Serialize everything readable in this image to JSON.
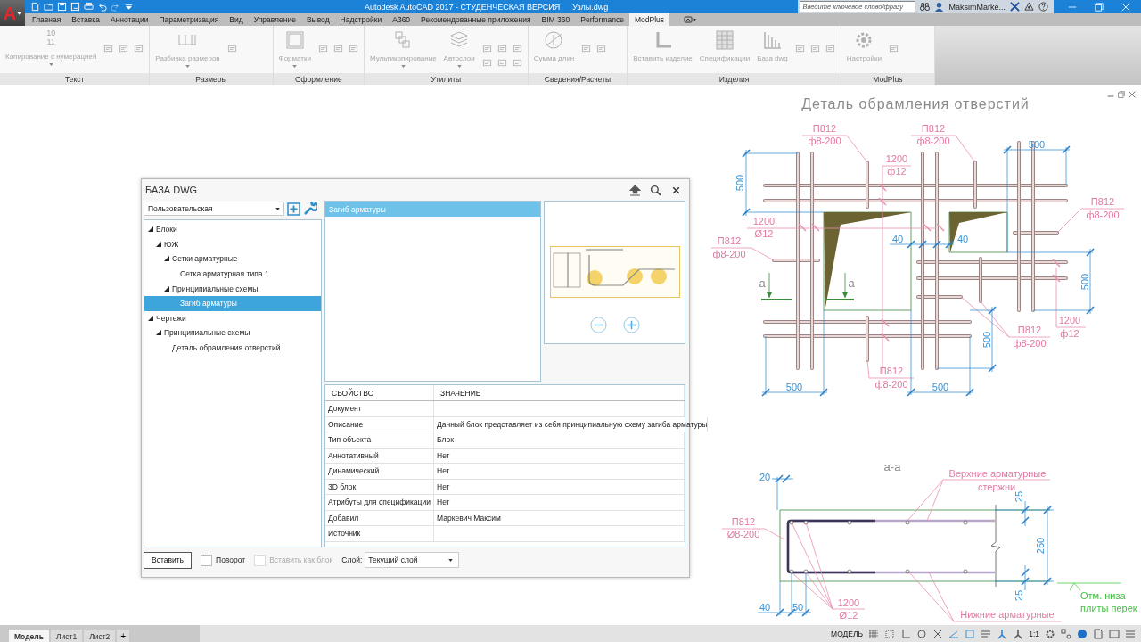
{
  "titlebar": {
    "app_letter": "A",
    "title": "Autodesk AutoCAD 2017 - СТУДЕНЧЕСКАЯ ВЕРСИЯ",
    "file": "Узлы.dwg",
    "search": {
      "placeholder": "Введите ключевое слово/фразу"
    },
    "user": "MaksimMarke..."
  },
  "ribbon_tabs": [
    {
      "label": "Главная",
      "selected": false
    },
    {
      "label": "Вставка",
      "selected": false
    },
    {
      "label": "Аннотации",
      "selected": false
    },
    {
      "label": "Параметризация",
      "selected": false
    },
    {
      "label": "Вид",
      "selected": false
    },
    {
      "label": "Управление",
      "selected": false
    },
    {
      "label": "Вывод",
      "selected": false
    },
    {
      "label": "Надстройки",
      "selected": false
    },
    {
      "label": "A360",
      "selected": false
    },
    {
      "label": "Рекомендованные приложения",
      "selected": false
    },
    {
      "label": "BIM 360",
      "selected": false
    },
    {
      "label": "Performance",
      "selected": false
    },
    {
      "label": "ModPlus",
      "selected": true
    }
  ],
  "ribbon_panels": [
    {
      "title": "Текст",
      "buttons": [
        {
          "label": "Копирование с нумерацией",
          "dropdown": true,
          "icon_text": [
            "10",
            "11"
          ]
        }
      ]
    },
    {
      "title": "Размеры",
      "buttons": [
        {
          "label": "Разбивка размеров",
          "dropdown": true
        }
      ]
    },
    {
      "title": "Оформление",
      "buttons": [
        {
          "label": "Форматки",
          "dropdown": true
        }
      ]
    },
    {
      "title": "Утилиты",
      "buttons": [
        {
          "label": "Мультикопирование",
          "dropdown": true
        },
        {
          "label": "Автослои",
          "dropdown": true
        }
      ]
    },
    {
      "title": "Сведения/Расчеты",
      "buttons": [
        {
          "label": "Сумма длин",
          "dropdown": false
        }
      ]
    },
    {
      "title": "Изделия",
      "buttons": [
        {
          "label": "Вставить изделие",
          "dropdown": false
        },
        {
          "label": "Спецификации",
          "dropdown": false
        },
        {
          "label": "База dwg",
          "dropdown": false
        }
      ]
    },
    {
      "title": "ModPlus",
      "buttons": [
        {
          "label": "Настройки",
          "dropdown": false
        }
      ]
    }
  ],
  "dialog": {
    "title": "БАЗА DWG",
    "category": {
      "value": "Пользовательская"
    },
    "tree": [
      {
        "label": "Блоки",
        "expanded": true,
        "selected": false,
        "children": [
          {
            "label": "ЮЖ",
            "expanded": true,
            "selected": false,
            "children": [
              {
                "label": "Сетки арматурные",
                "expanded": true,
                "selected": false,
                "children": [
                  {
                    "label": "Сетка арматурная типа 1",
                    "selected": false
                  }
                ]
              },
              {
                "label": "Принципиальные схемы",
                "expanded": true,
                "selected": false,
                "children": [
                  {
                    "label": "Загиб арматуры",
                    "selected": true
                  }
                ]
              }
            ]
          }
        ]
      },
      {
        "label": "Чертежи",
        "expanded": true,
        "selected": false,
        "children": [
          {
            "label": "Принципиальные схемы",
            "expanded": true,
            "selected": false,
            "children": [
              {
                "label": "Деталь обрамления отверстий",
                "selected": false
              }
            ]
          }
        ]
      }
    ],
    "items": [
      {
        "label": "Загиб арматуры",
        "selected": true
      }
    ],
    "properties": {
      "columns": [
        "СВОЙСТВО",
        "ЗНАЧЕНИЕ"
      ],
      "rows": [
        {
          "name": "Документ"
        },
        {
          "name": "Описание",
          "value": "Данный блок представляет из себя принципиальную схему загиба арматуры"
        },
        {
          "name": "Тип объекта",
          "value": "Блок"
        },
        {
          "name": "Аннотативный",
          "value": "Нет"
        },
        {
          "name": "Динамический",
          "value": "Нет"
        },
        {
          "name": "3D блок",
          "value": "Нет"
        },
        {
          "name": "Атрибуты для спецификации",
          "value": "Нет"
        },
        {
          "name": "Добавил",
          "value": "Маркевич Максим"
        },
        {
          "name": "Источник"
        }
      ]
    },
    "insert_button": "Вставить",
    "options": [
      {
        "label": "Поворот",
        "checked": false,
        "disabled": false
      },
      {
        "label": "Вставить как блок",
        "checked": false,
        "disabled": true
      }
    ],
    "layer": {
      "label": "Слой:",
      "value": "Текущий слой"
    }
  },
  "drawing": {
    "labels": [
      {
        "kind": "title",
        "text": "Деталь обрамления отверстий"
      },
      {
        "kind": "mark",
        "text": "П812"
      },
      {
        "kind": "mark",
        "text": "ф8-200"
      },
      {
        "kind": "mark",
        "text": "П812"
      },
      {
        "kind": "mark",
        "text": "ф8-200"
      },
      {
        "kind": "mark",
        "text": "1200"
      },
      {
        "kind": "mark",
        "text": "ф12"
      },
      {
        "kind": "dim",
        "text": "500"
      },
      {
        "kind": "dim_v",
        "text": "500"
      },
      {
        "kind": "mark",
        "text": "П812"
      },
      {
        "kind": "mark",
        "text": "ф8-200"
      },
      {
        "kind": "mark",
        "text": "1200"
      },
      {
        "kind": "mark",
        "text": "Ø12"
      },
      {
        "kind": "mark",
        "text": "П812"
      },
      {
        "kind": "mark",
        "text": "ф8-200"
      },
      {
        "kind": "dim",
        "text": "40"
      },
      {
        "kind": "dim",
        "text": "40"
      },
      {
        "kind": "section",
        "text": "а"
      },
      {
        "kind": "section",
        "text": "а"
      },
      {
        "kind": "dim_v",
        "text": "500"
      },
      {
        "kind": "mark",
        "text": "1200"
      },
      {
        "kind": "mark",
        "text": "ф12"
      },
      {
        "kind": "mark",
        "text": "П812"
      },
      {
        "kind": "mark",
        "text": "ф8-200"
      },
      {
        "kind": "dim_v",
        "text": "500"
      },
      {
        "kind": "mark",
        "text": "П812"
      },
      {
        "kind": "dim",
        "text": "500"
      },
      {
        "kind": "mark",
        "text": "ф8-200"
      },
      {
        "kind": "dim",
        "text": "500"
      },
      {
        "kind": "section",
        "text": "а-а"
      },
      {
        "kind": "mark",
        "text": "Верхние арматурные"
      },
      {
        "kind": "mark",
        "text": "стержни"
      },
      {
        "kind": "dim",
        "text": "20"
      },
      {
        "kind": "dim_v",
        "text": "25"
      },
      {
        "kind": "mark",
        "text": "П812"
      },
      {
        "kind": "mark",
        "text": "Ø8-200"
      },
      {
        "kind": "dim_v",
        "text": "250"
      },
      {
        "kind": "dim_v",
        "text": "25"
      },
      {
        "kind": "note",
        "text": "Отм. низа"
      },
      {
        "kind": "dim",
        "text": "40"
      },
      {
        "kind": "dim",
        "text": "50"
      },
      {
        "kind": "mark",
        "text": "1200"
      },
      {
        "kind": "note",
        "text": "плиты перек"
      },
      {
        "kind": "mark",
        "text": "Ø12"
      },
      {
        "kind": "mark",
        "text": "Нижние арматурные"
      }
    ]
  },
  "status_bar": {
    "layout_tabs": [
      {
        "label": "Модель",
        "selected": true
      },
      {
        "label": "Лист1",
        "selected": false
      },
      {
        "label": "Лист2",
        "selected": false
      }
    ],
    "add_tab": "+",
    "space": "МОДЕЛЬ",
    "scale": "1:1"
  }
}
